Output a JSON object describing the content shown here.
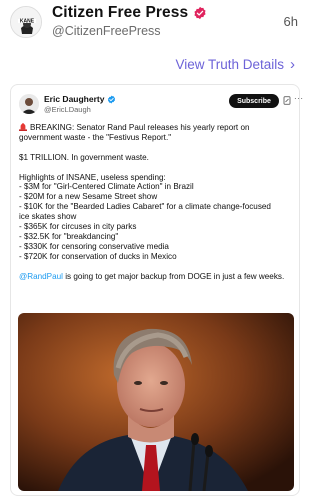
{
  "header": {
    "name": "Citizen Free Press",
    "handle": "@CitizenFreePress",
    "time": "6h",
    "avatar_text": "KANE"
  },
  "link": {
    "label": "View Truth Details",
    "chevron": "›"
  },
  "tweet": {
    "author": "Eric Daugherty",
    "handle": "@EricLDaugh",
    "subscribe_label": "Subscribe",
    "more_icon": "···",
    "lines": [
      "BREAKING: Senator Rand Paul releases his yearly report on",
      "government waste - the \"Festivus Report.\"",
      "$1 TRILLION. In government waste.",
      "Highlights of INSANE, useless spending:",
      "- $3M for \"Girl-Centered Climate Action\" in Brazil",
      "- $20M for a new Sesame Street show",
      "- $10K for the \"Bearded Ladies Cabaret\" for a climate change-focused",
      "ice skates show",
      "- $365K for circuses in city parks",
      "- $32.5K for \"breakdancing\"",
      "- $330K for censoring conservative media",
      "- $720K for conservation of ducks in Mexico"
    ],
    "mention": "@RandPaul",
    "closing": " is going to get major backup from DOGE in just a few weeks."
  },
  "colors": {
    "link": "#6d63d8",
    "verified_pink": "#e0245e",
    "verified_blue": "#1d9bf0",
    "mention": "#1d9bf0"
  },
  "icons": {
    "verified_main": "verified-badge-icon",
    "verified_inner": "verified-badge-icon",
    "siren": "siren-icon",
    "grok": "grok-icon",
    "more": "more-icon",
    "chevron": "chevron-right-icon"
  }
}
